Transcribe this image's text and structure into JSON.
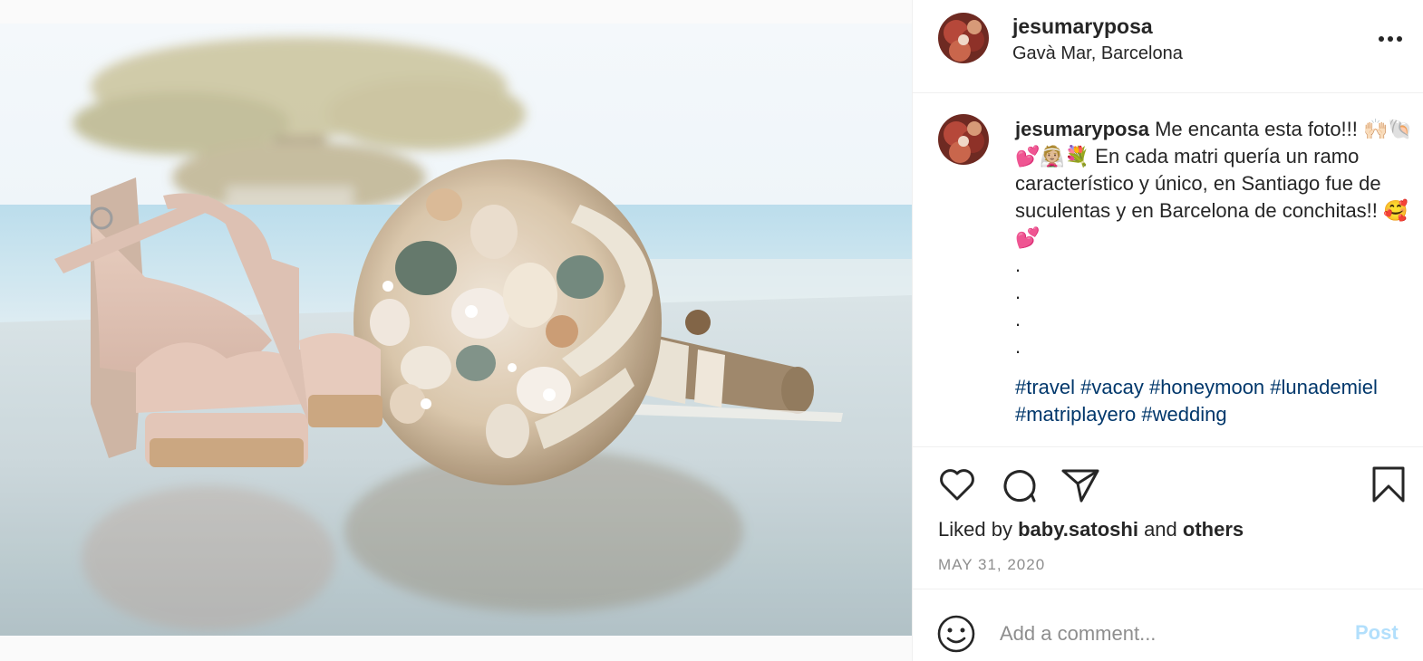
{
  "post": {
    "username": "jesumaryposa",
    "location": "Gavà Mar, Barcelona",
    "more_icon": "more-horizontal-icon",
    "photo_alt": ""
  },
  "caption": {
    "username": "jesumaryposa",
    "text": "Me encanta esta foto!!! 🙌🏻🐚💕👰🏼💐 En cada matri quería un ramo característico y único, en Santiago fue de suculentas y en Barcelona de conchitas!! 🥰💕",
    "dots": [
      ".",
      ".",
      ".",
      "."
    ],
    "hashtags": "#travel #vacay #honeymoon #lunademiel #matriplayero #wedding"
  },
  "actions": {
    "icons": [
      "heart-icon",
      "comment-icon",
      "share-icon",
      "bookmark-icon"
    ],
    "liked_by_prefix": "Liked by",
    "liked_by_user": "baby.satoshi",
    "liked_by_and": "and",
    "liked_by_others": "others",
    "date": "MAY 31, 2020"
  },
  "comment": {
    "placeholder": "Add a comment...",
    "post_label": "Post",
    "emoji_icon": "smiley-icon"
  },
  "colors": {
    "link": "#00376b",
    "post_disabled": "#b2dffc",
    "muted": "#8e8e8e",
    "border": "#efefef"
  }
}
